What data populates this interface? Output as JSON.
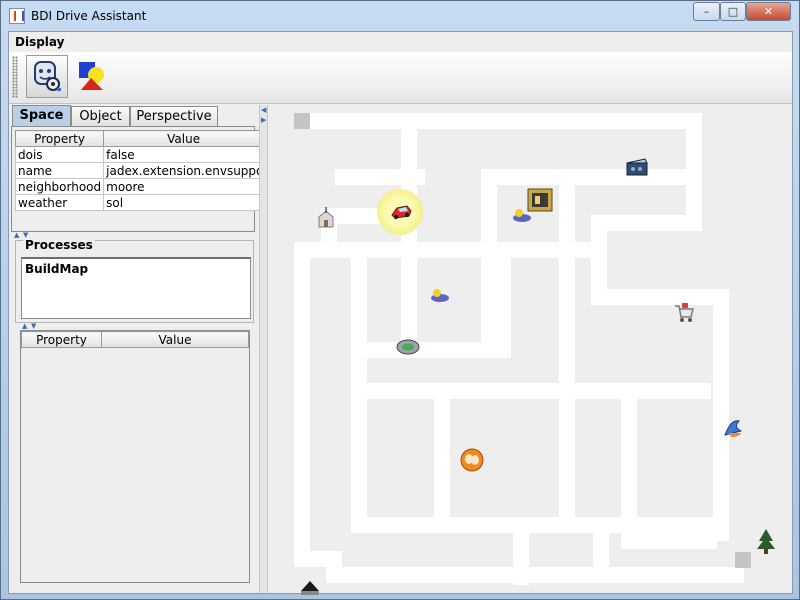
{
  "window": {
    "title": "BDI Drive Assistant",
    "controls": {
      "minimize": "–",
      "maximize": "□",
      "close": "✕"
    }
  },
  "display": {
    "label": "Display"
  },
  "toolbar": {
    "buttons": [
      {
        "icon": "avatar-gear-icon"
      },
      {
        "icon": "shapes-icon"
      }
    ]
  },
  "tabs": [
    "Space",
    "Object",
    "Perspective"
  ],
  "space_table": {
    "headers": [
      "Property",
      "Value"
    ],
    "rows": [
      [
        "dois",
        "false"
      ],
      [
        "name",
        "jadex.extension.envsuppor…"
      ],
      [
        "neighborhood",
        "moore"
      ],
      [
        "weather",
        "sol"
      ]
    ]
  },
  "processes": {
    "title": "Processes",
    "items": [
      "BuildMap"
    ]
  },
  "process_table": {
    "headers": [
      "Property",
      "Value"
    ]
  },
  "colors": {
    "title_bg": "#b9d1ea",
    "tab_active": "#b8cfe5",
    "road": "#ffffff",
    "map_bg": "#eeeeee",
    "highlight": "#f5f08a"
  },
  "map_objects": [
    "car-icon",
    "church-icon",
    "gas-station-icon",
    "flag-icon",
    "walker-icon",
    "stadium-icon",
    "theater-icon",
    "cinema-icon",
    "tree-icon",
    "shopping-cart-icon",
    "parking-icon",
    "construction-icon"
  ]
}
